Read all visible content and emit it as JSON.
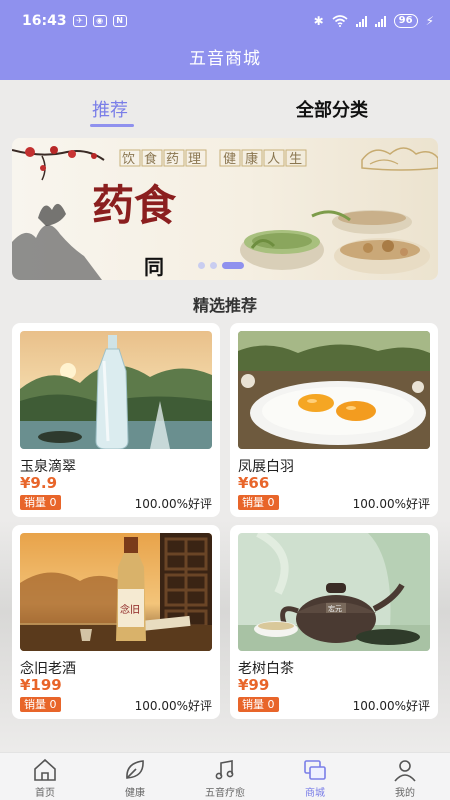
{
  "status_bar": {
    "time": "16:43",
    "battery": "96"
  },
  "header": {
    "title": "五音商城"
  },
  "tabs": [
    {
      "label": "推荐",
      "active": true
    },
    {
      "label": "全部分类",
      "active": false
    }
  ],
  "banner": {
    "caption_top": "饮食药理 健康人生",
    "caption_main": "药食",
    "caption_sub": "同",
    "slide_count": 3,
    "active_slide": 3
  },
  "section_title": "精选推荐",
  "products": [
    {
      "name": "玉泉滴翠",
      "price": "¥9.9",
      "sales": "销量 0",
      "rating": "100.00%好评"
    },
    {
      "name": "凤展白羽",
      "price": "¥66",
      "sales": "销量 0",
      "rating": "100.00%好评"
    },
    {
      "name": "念旧老酒",
      "price": "¥199",
      "sales": "销量 0",
      "rating": "100.00%好评"
    },
    {
      "name": "老树白茶",
      "price": "¥99",
      "sales": "销量 0",
      "rating": "100.00%好评"
    }
  ],
  "product_images": {
    "bottle_label": "念旧",
    "teapot_label": "宏元"
  },
  "nav": [
    {
      "label": "首页",
      "icon": "home-icon",
      "active": false
    },
    {
      "label": "健康",
      "icon": "leaf-icon",
      "active": false
    },
    {
      "label": "五音疗愈",
      "icon": "music-note-icon",
      "active": false
    },
    {
      "label": "商城",
      "icon": "shop-icon",
      "active": true
    },
    {
      "label": "我的",
      "icon": "user-icon",
      "active": false
    }
  ],
  "colors": {
    "accent": "#8f91ee",
    "price": "#e8652a"
  }
}
